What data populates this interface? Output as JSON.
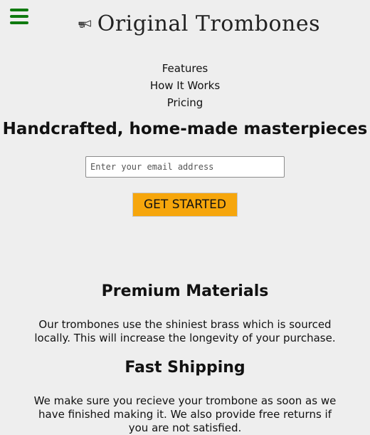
{
  "header": {
    "logo_text": "Original Trombones",
    "logo_icon": "trombone-icon",
    "menu_icon": "hamburger-menu-icon"
  },
  "nav": {
    "items": [
      "Features",
      "How It Works",
      "Pricing"
    ]
  },
  "hero": {
    "title": "Handcrafted, home-made masterpieces",
    "email_placeholder": "Enter your email address",
    "cta_label": "GET STARTED"
  },
  "features": [
    {
      "title": "Premium Materials",
      "text": "Our trombones use the shiniest brass which is sourced locally. This will increase the longevity of your purchase."
    },
    {
      "title": "Fast Shipping",
      "text": "We make sure you recieve your trombone as soon as we have finished making it. We also provide free returns if you are not satisfied."
    }
  ],
  "colors": {
    "background": "#eeeeee",
    "menu_icon": "#0f7a0f",
    "cta_background": "#f6a60c"
  }
}
